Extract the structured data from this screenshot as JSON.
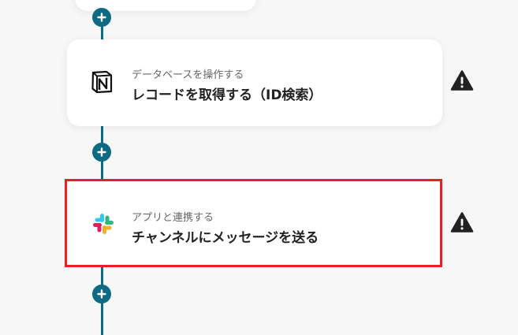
{
  "colors": {
    "connector": "#0e6a83",
    "selection_border": "#e02424",
    "warning": "#222222"
  },
  "steps": [
    {
      "app_icon": "notion-icon",
      "category": "データベースを操作する",
      "title": "レコードを取得する（ID検索）",
      "status_icon": "warning-icon"
    },
    {
      "app_icon": "slack-icon",
      "category": "アプリと連携する",
      "title": "チャンネルにメッセージを送る",
      "status_icon": "warning-icon",
      "selected": true
    }
  ],
  "add_step_icon": "plus-icon"
}
